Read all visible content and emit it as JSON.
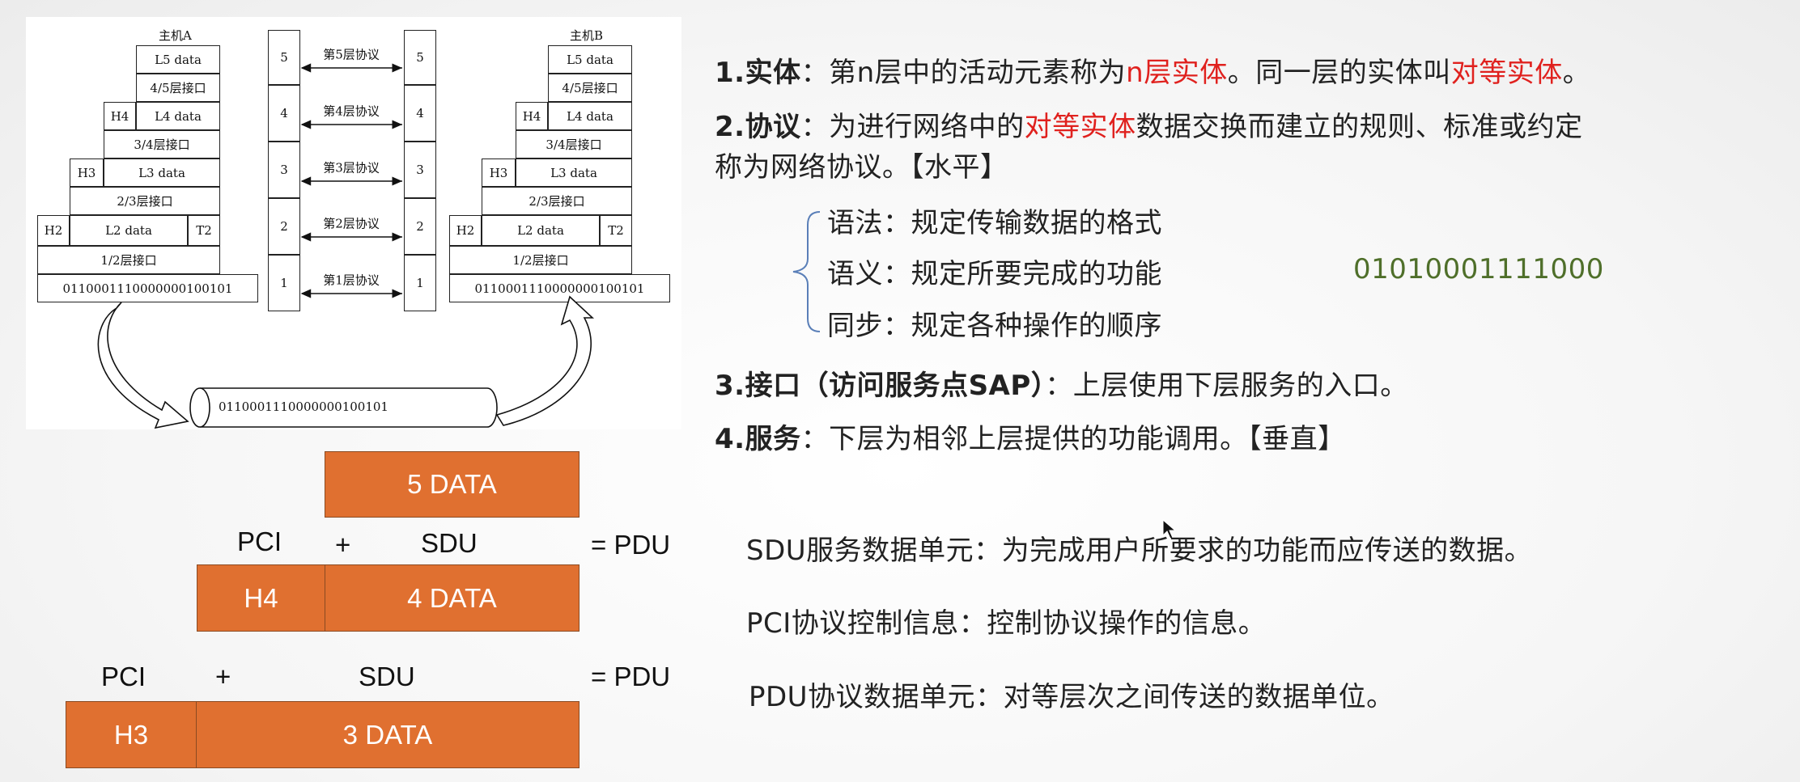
{
  "diagram": {
    "host_a": "主机A",
    "host_b": "主机B",
    "host_stack": {
      "l5": "L5 data",
      "if45": "4/5层接口",
      "h4": "H4",
      "l4": "L4 data",
      "if34": "3/4层接口",
      "h3": "H3",
      "l3": "L3 data",
      "if23": "2/3层接口",
      "h2": "H2",
      "l2": "L2 data",
      "t2": "T2",
      "if12": "1/2层接口",
      "bits": "0110001110000000100101"
    },
    "layer_numbers": [
      "5",
      "4",
      "3",
      "2",
      "1"
    ],
    "protocols": [
      "第5层协议",
      "第4层协议",
      "第3层协议",
      "第2层协议",
      "第1层协议"
    ],
    "cable_bits": "0110001110000000100101"
  },
  "definitions": {
    "entity": {
      "title": "1.实体",
      "colon": "：",
      "text1": "第n层中的活动元素称为",
      "red1": "n层实体",
      "text2": "。同一层的实体叫",
      "red2": "对等实体",
      "text3": "。"
    },
    "protocol": {
      "title": "2.协议",
      "colon": "：",
      "text1": "为进行网络中的",
      "red1": "对等实体",
      "text2": "数据交换而建立的规则、标准或约定",
      "line2": "称为网络协议。【水平】"
    },
    "elements": [
      "语法：规定传输数据的格式",
      "语义：规定所要完成的功能",
      "同步：规定各种操作的顺序"
    ],
    "binary_example": "01010001111000",
    "interface": {
      "title": "3.接口（访问服务点SAP）",
      "colon": "：",
      "text": "上层使用下层服务的入口。"
    },
    "service": {
      "title": "4.服务",
      "colon": "：",
      "text": "下层为相邻上层提供的功能调用。【垂直】"
    },
    "sdu": "SDU服务数据单元：为完成用户所要求的功能而应传送的数据。",
    "pci": "PCI协议控制信息：控制协议操作的信息。",
    "pdu": "PDU协议数据单元：对等层次之间传送的数据单位。"
  },
  "pdu_diagram": {
    "row5_data": "5 DATA",
    "pci": "PCI",
    "plus": "+",
    "sdu": "SDU",
    "eq_pdu": "= PDU",
    "h4": "H4",
    "row4_data": "4 DATA",
    "h3": "H3",
    "row3_data": "3 DATA"
  },
  "colors": {
    "orange": "#e07030",
    "red": "#e0211e",
    "green": "#4f6f2a"
  }
}
